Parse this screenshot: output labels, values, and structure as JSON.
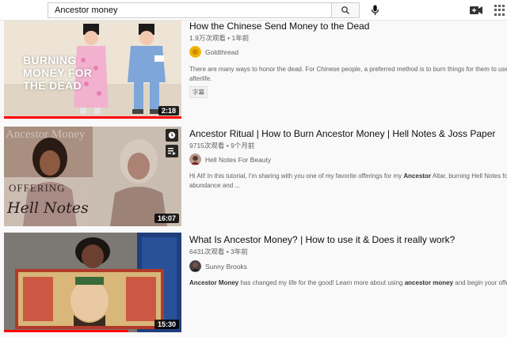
{
  "search": {
    "query": "Ancestor money"
  },
  "results": [
    {
      "title": "How the Chinese Send Money to the Dead",
      "meta": "1.9万次观看 • 1年前",
      "channel": "Goldthread",
      "desc": [
        "There are many ways to honor the dead. For Chinese people, a preferred method is to burn things for them to use in the",
        "afterlife."
      ],
      "badge": "字幕",
      "duration": "2:18",
      "thumb_text": [
        "BURNING",
        "MONEY FOR",
        "THE DEAD"
      ],
      "progress": 1.0
    },
    {
      "title": "Ancestor Ritual | How to Burn Ancestor Money | Hell Notes & Joss Paper",
      "meta": "9715次观看 • 9个月前",
      "channel": "Hell Notes For Beauty",
      "desc_pre": "Hi All! In this tutorial, I'm sharing with you one of my favorite offerings for my ",
      "desc_bold": "Ancestor",
      "desc_post": " Altar, burning Hell Notes for",
      "desc2": "abundance and ...",
      "duration": "16:07",
      "thumb_text": [
        "Ancestor Money",
        "OFFERING",
        "Hell Notes"
      ],
      "progress": 0.0
    },
    {
      "title": "What Is Ancestor Money? | How to use it & Does it really work?",
      "meta": "6431次观看 • 3年前",
      "channel": "Sunny Brooks",
      "desc_b1": "Ancestor Money",
      "desc_m1": " has changed my life for the good! Learn more about using ",
      "desc_b2": "ancestor money",
      "desc_m2": " and begin your offer",
      "duration": "15:30",
      "progress": 0.7
    }
  ],
  "icons": [
    "search-icon",
    "mic-icon",
    "create-video-icon",
    "apps-icon",
    "watch-later-icon",
    "add-to-queue-icon"
  ],
  "colors": {
    "accent": "#ff0000",
    "thumb1_bg": "#e8dfd2",
    "thumb1_text": "#ffffff",
    "thumb2_bg": "#b7a79a"
  }
}
